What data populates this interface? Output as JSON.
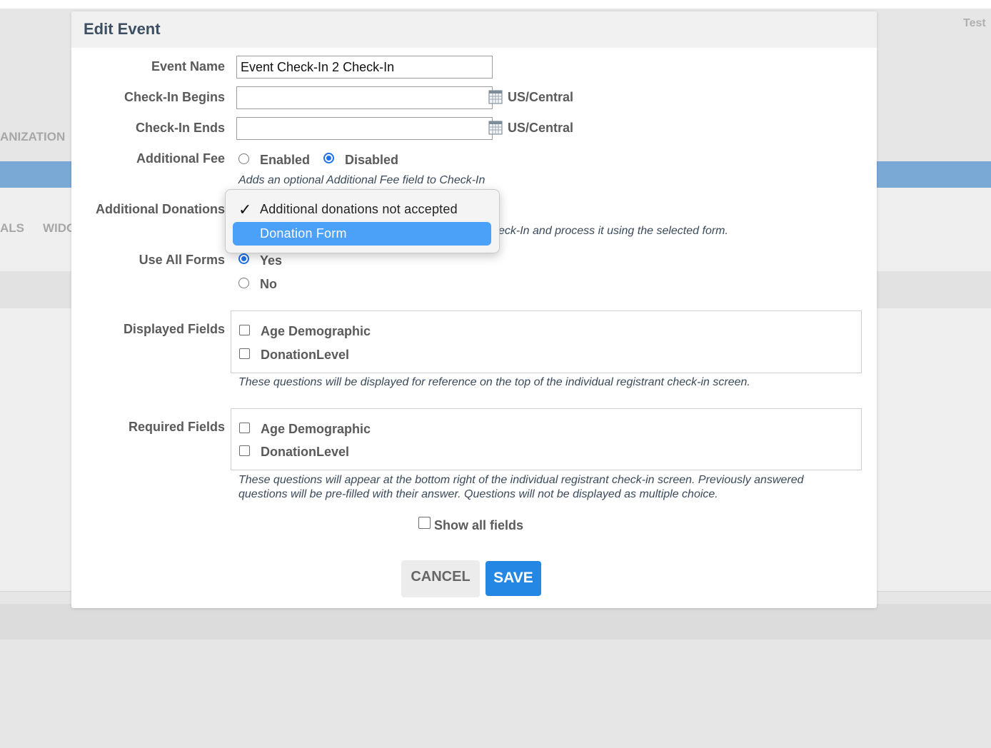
{
  "background": {
    "org_tab_fragment": "ANIZATION",
    "tab_fragment_1": "ALS",
    "tab_fragment_2": "WIDG",
    "top_right_fragment": "Test"
  },
  "modal": {
    "title": "Edit Event",
    "event_name": {
      "label": "Event Name",
      "value": "Event Check-In 2 Check-In"
    },
    "check_in_begins": {
      "label": "Check-In Begins",
      "value": "",
      "timezone": "US/Central",
      "icon": "calendar-icon"
    },
    "check_in_ends": {
      "label": "Check-In Ends",
      "value": "",
      "timezone": "US/Central",
      "icon": "calendar-icon"
    },
    "additional_fee": {
      "label": "Additional Fee",
      "options": [
        "Enabled",
        "Disabled"
      ],
      "selected": "Disabled",
      "help": "Adds an optional Additional Fee field to Check-In"
    },
    "additional_donations": {
      "label": "Additional Donations",
      "help_visible_fragment": "eck-In and process it using the selected form.",
      "dropdown_options": [
        "Additional donations not accepted",
        "Donation Form"
      ],
      "checked_option": "Additional donations not accepted",
      "highlighted_option": "Donation Form"
    },
    "use_all_forms": {
      "label": "Use All Forms",
      "options": [
        "Yes",
        "No"
      ],
      "selected": "Yes"
    },
    "displayed_fields": {
      "label": "Displayed Fields",
      "items": [
        "Age Demographic",
        "DonationLevel"
      ],
      "help": "These questions will be displayed for reference on the top of the individual registrant check-in screen."
    },
    "required_fields": {
      "label": "Required Fields",
      "items": [
        "Age Demographic",
        "DonationLevel"
      ],
      "help_line1": "These questions will appear at the bottom right of the individual registrant check-in screen. Previously answered",
      "help_line2": "questions will be pre-filled with their answer. Questions will not be displayed as multiple choice."
    },
    "show_all_fields": {
      "label": "Show all fields",
      "checked": false
    },
    "cancel_label": "CANCEL",
    "save_label": "SAVE"
  },
  "colors": {
    "accent_blue": "#2487e3",
    "highlight_blue": "#4ba0f7",
    "title_color": "#3d4f62"
  }
}
